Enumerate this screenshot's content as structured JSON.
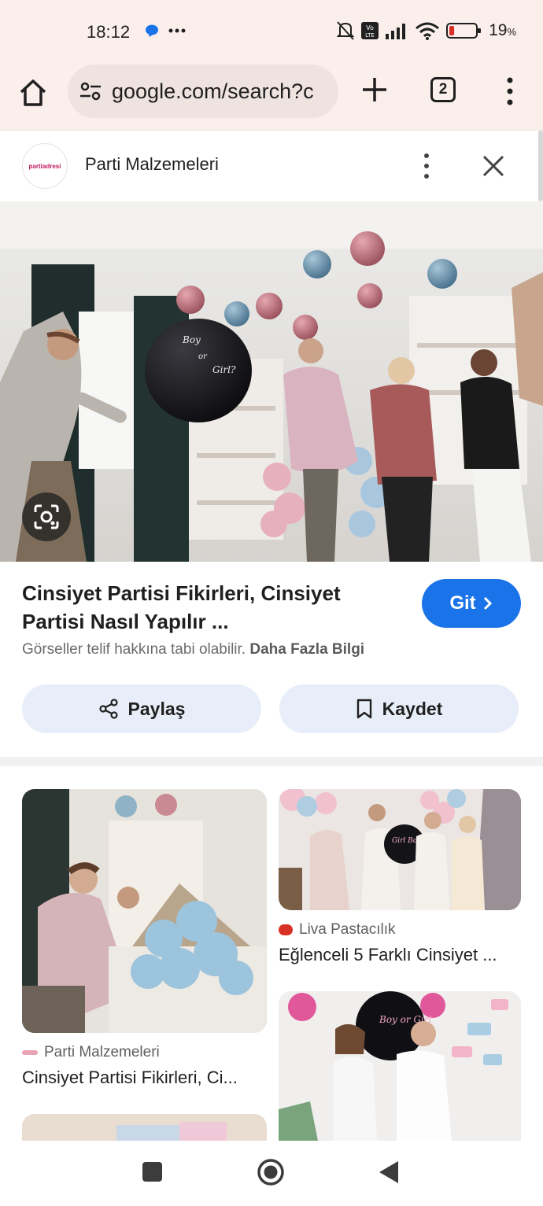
{
  "status_bar": {
    "time": "18:12",
    "battery_percent": "19",
    "battery_unit": "%",
    "battery_level": 0.19,
    "battery_color": "#d93025"
  },
  "browser": {
    "url": "google.com/search?c",
    "tab_count": "2"
  },
  "source": {
    "name": "Parti Malzemeleri",
    "logo_text": "partiadresi"
  },
  "result": {
    "title": "Cinsiyet Partisi Fikirleri, Cinsiyet Partisi Nasıl Yapılır ...",
    "go_label": "Git",
    "copyright_text": "Görseller telif hakkına tabi olabilir.",
    "more_info_link": "Daha Fazla Bilgi",
    "share_label": "Paylaş",
    "save_label": "Kaydet",
    "go_color": "#1a73e8"
  },
  "related": [
    {
      "source": "Parti Malzemeleri",
      "title": "Cinsiyet Partisi Fikirleri, Ci..."
    },
    {
      "source": "Liva Pastacılık",
      "title": "Eğlenceli 5 Farklı Cinsiyet ..."
    }
  ],
  "hero_balloon_text": {
    "line1": "Boy",
    "line2": "or",
    "line3": "Girl?"
  },
  "card_balloon_text": {
    "top_right": "Girl Boy?",
    "bottom_right": "Boy or Girl"
  },
  "icons": [
    "home-icon",
    "tune-icon",
    "plus-icon",
    "tabs-icon",
    "more-vert-icon",
    "close-icon",
    "google-lens-icon",
    "share-icon",
    "bookmark-icon",
    "chevron-right-icon",
    "nav-recents-icon",
    "nav-home-icon",
    "nav-back-icon"
  ]
}
